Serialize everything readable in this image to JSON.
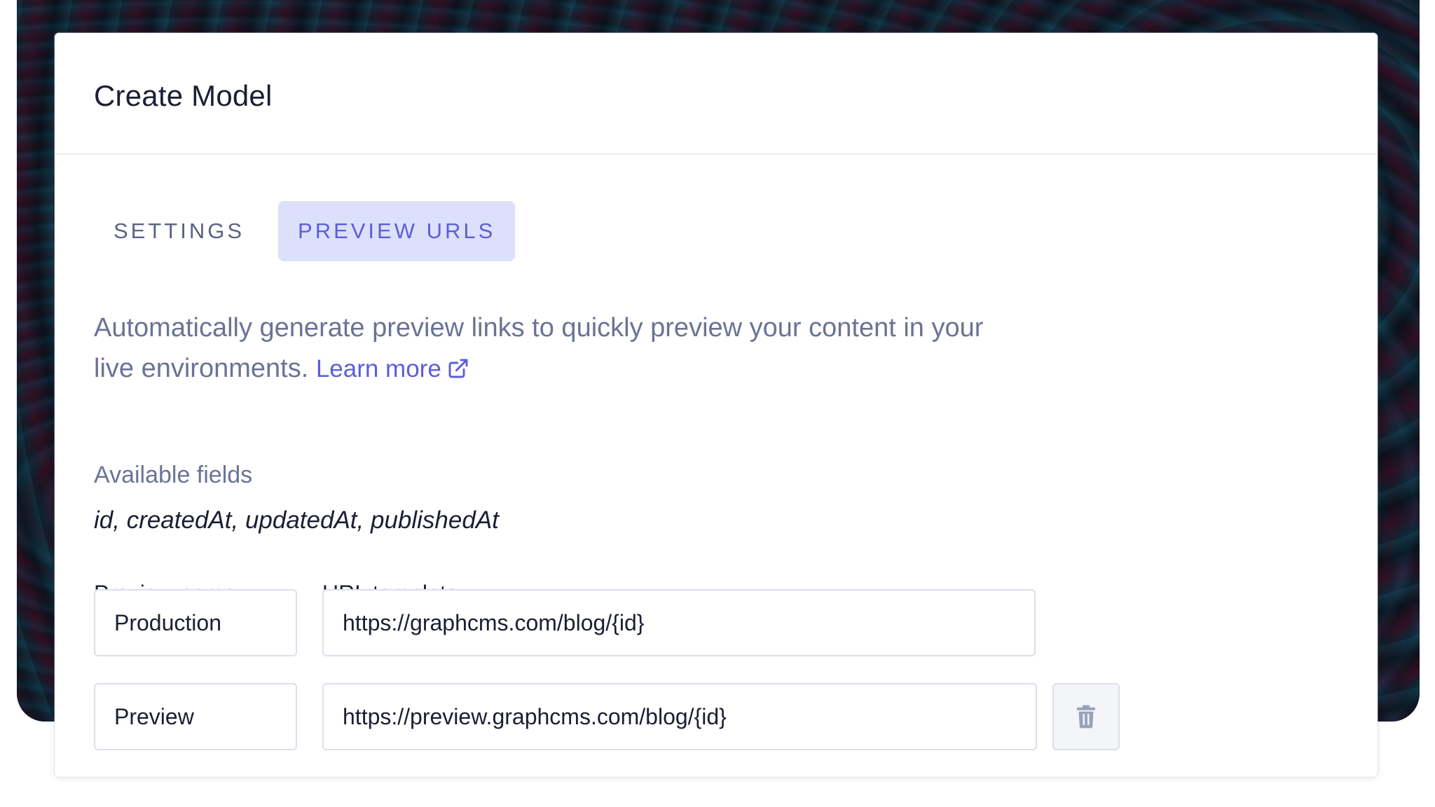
{
  "modal": {
    "title": "Create Model"
  },
  "tabs": [
    {
      "label": "SETTINGS",
      "active": false
    },
    {
      "label": "PREVIEW URLS",
      "active": true
    }
  ],
  "description": {
    "text": "Automatically generate preview links to quickly preview your content in your live environments.",
    "link_label": "Learn more",
    "link_icon": "external-link-icon"
  },
  "available_fields": {
    "label": "Available fields",
    "value": "id, createdAt, updatedAt, publishedAt"
  },
  "columns": {
    "preview_name": "Preview name",
    "url_template": "URL template"
  },
  "rows": [
    {
      "name": "Production",
      "url": "https://graphcms.com/blog/{id}"
    },
    {
      "name": "Preview",
      "url": "https://preview.graphcms.com/blog/{id}",
      "delete_icon": "trash-icon"
    }
  ],
  "colors": {
    "accent": "#5b5fd8",
    "accent_bg": "#dde0fb",
    "muted_text": "#6b7395",
    "heading_text": "#1c1e33",
    "border": "#dcdfe9"
  }
}
